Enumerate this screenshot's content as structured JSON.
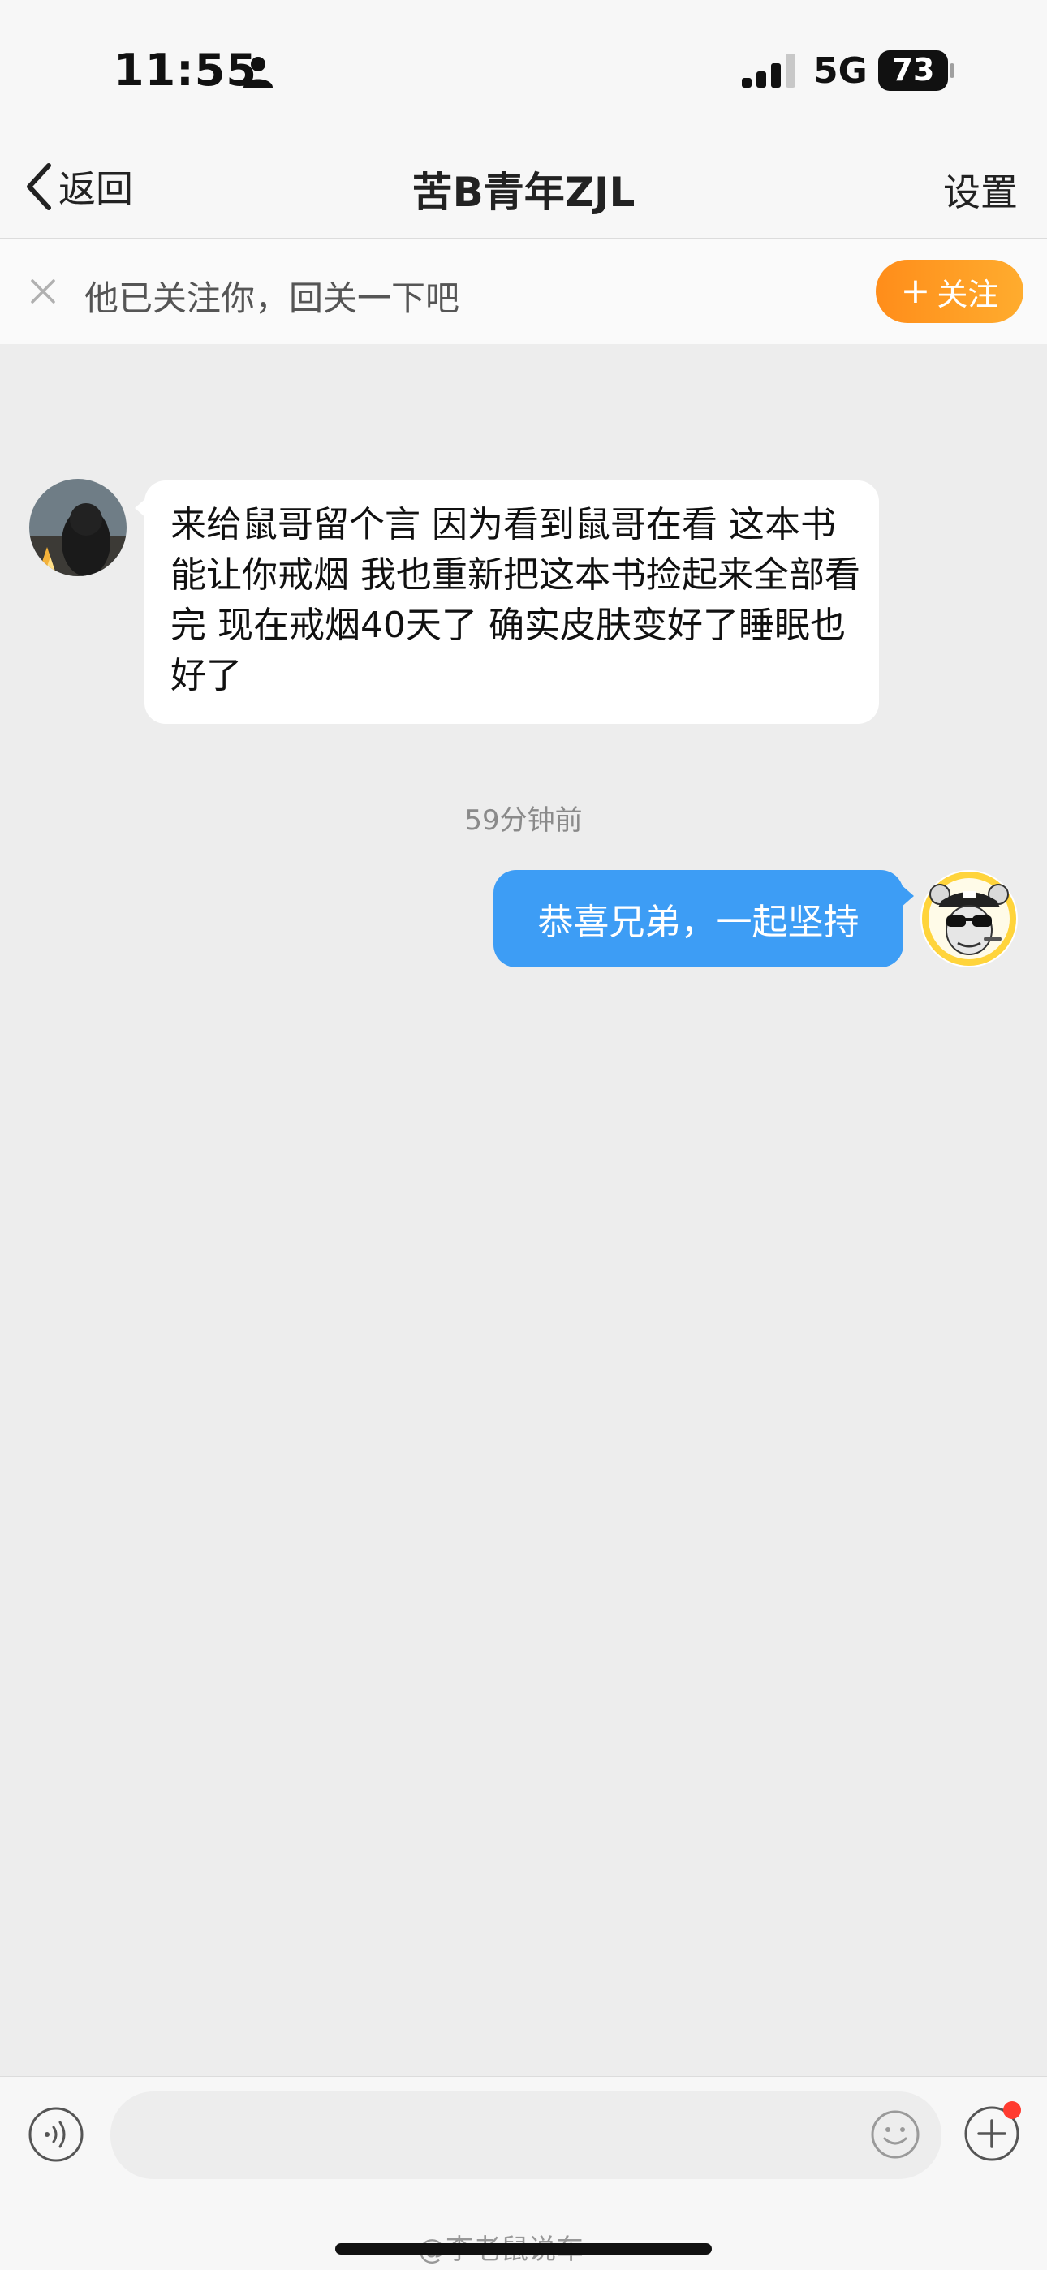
{
  "status_bar": {
    "time": "11:55",
    "network": "5G",
    "battery": "73",
    "icons": [
      "person-icon",
      "signal-icon",
      "battery-icon"
    ]
  },
  "nav": {
    "back_label": "返回",
    "title": "苦B青年ZJL",
    "settings_label": "设置"
  },
  "follow_banner": {
    "text": "他已关注你，回关一下吧",
    "button_label": "关注",
    "button_plus": "+",
    "button_color": "#ff9a1f"
  },
  "messages": [
    {
      "side": "left",
      "text": "来给鼠哥留个言 因为看到鼠哥在看 这本书能让你戒烟 我也重新把这本书捡起来全部看完 现在戒烟40天了 确实皮肤变好了睡眠也好了"
    },
    {
      "side": "right",
      "text": "恭喜兄弟，一起坚持"
    }
  ],
  "timestamp": "59分钟前",
  "input_bar": {
    "placeholder": "",
    "icons": [
      "voice-icon",
      "emoji-icon",
      "plus-icon"
    ]
  },
  "watermark": "@李老鼠说车",
  "colors": {
    "background": "#ededed",
    "outgoing_bubble": "#3d9df5",
    "incoming_bubble": "#ffffff",
    "accent_orange": "#ff9a1f",
    "notification_dot": "#ff3b30"
  }
}
